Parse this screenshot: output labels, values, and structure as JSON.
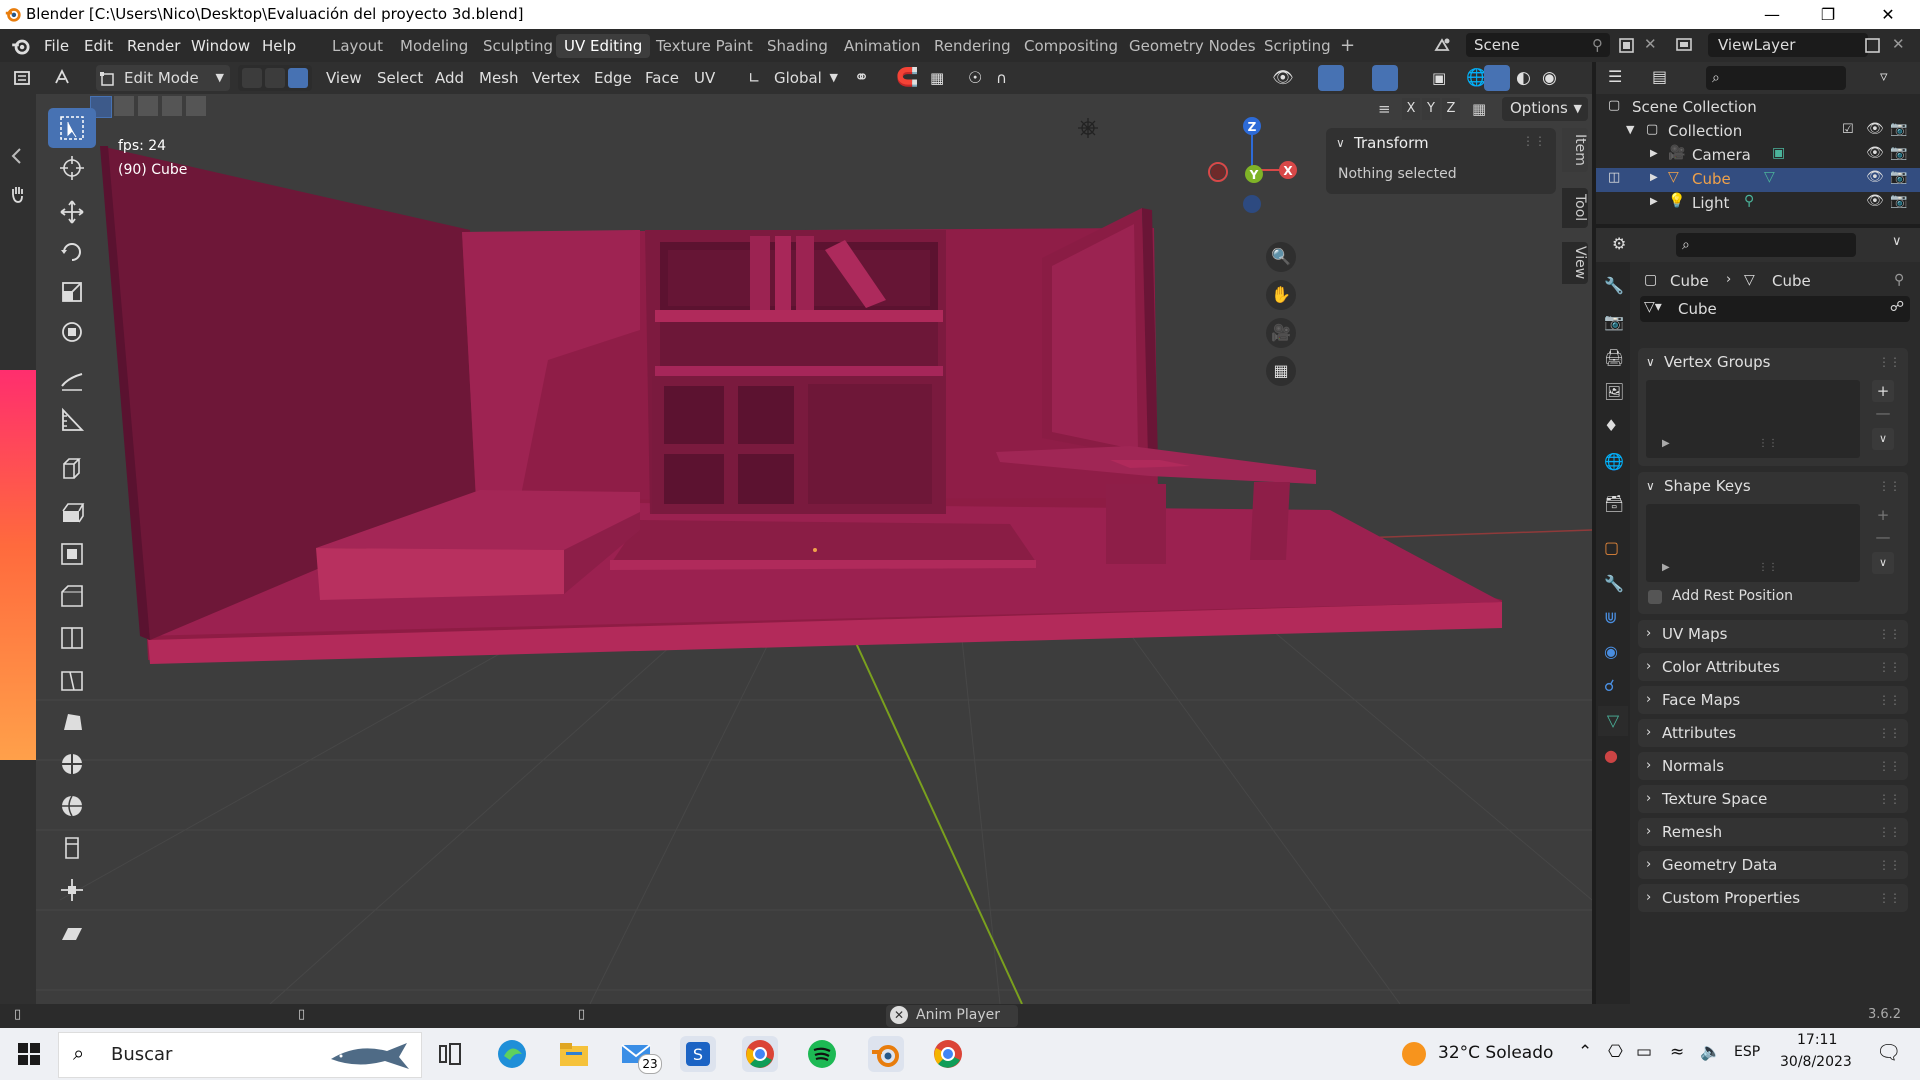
{
  "window": {
    "title": "Blender [C:\\Users\\Nico\\Desktop\\Evaluación del proyecto 3d.blend]"
  },
  "menu": {
    "items": [
      "File",
      "Edit",
      "Render",
      "Window",
      "Help"
    ]
  },
  "workspaces": {
    "tabs": [
      "Layout",
      "Modeling",
      "Sculpting",
      "UV Editing",
      "Texture Paint",
      "Shading",
      "Animation",
      "Rendering",
      "Compositing",
      "Geometry Nodes",
      "Scripting"
    ],
    "active": "UV Editing",
    "add": "+"
  },
  "scene": {
    "name": "Scene",
    "view_layer": "ViewLayer"
  },
  "editor_header": {
    "mode": "Edit Mode",
    "menus": [
      "View",
      "Select",
      "Add",
      "Mesh",
      "Vertex",
      "Edge",
      "Face",
      "UV"
    ],
    "orientation": "Global",
    "options": "Options",
    "axes": [
      "X",
      "Y",
      "Z"
    ]
  },
  "viewport": {
    "fps": "fps: 24",
    "object_info": "(90) Cube",
    "nav_axes": {
      "x": "X",
      "y": "Y",
      "z": "Z"
    }
  },
  "npanel": {
    "header": "Transform",
    "message": "Nothing selected",
    "tabs": [
      "Item",
      "Tool",
      "View"
    ]
  },
  "outliner": {
    "rows": [
      {
        "label": "Scene Collection"
      },
      {
        "label": "Collection"
      },
      {
        "label": "Camera"
      },
      {
        "label": "Cube"
      },
      {
        "label": "Light"
      }
    ]
  },
  "properties": {
    "breadcrumb": {
      "object": "Cube",
      "data": "Cube"
    },
    "mesh_name": "Cube",
    "panels": {
      "vertex_groups": "Vertex Groups",
      "shape_keys": "Shape Keys",
      "add_rest_position": "Add Rest Position"
    },
    "collapsed": [
      "UV Maps",
      "Color Attributes",
      "Face Maps",
      "Attributes",
      "Normals",
      "Texture Space",
      "Remesh",
      "Geometry Data",
      "Custom Properties"
    ]
  },
  "statusbar": {
    "anim_player": "Anim Player",
    "version": "3.6.2"
  },
  "taskbar": {
    "search": "Buscar",
    "mail_badge": "23",
    "weather": "32°C Soleado",
    "lang": "ESP",
    "time": "17:11",
    "date": "30/8/2023"
  },
  "colors": {
    "accent": "#4772b3",
    "model": "#9a1e4a",
    "selected_row": "#334d80",
    "cube_label": "#f0a24a"
  }
}
